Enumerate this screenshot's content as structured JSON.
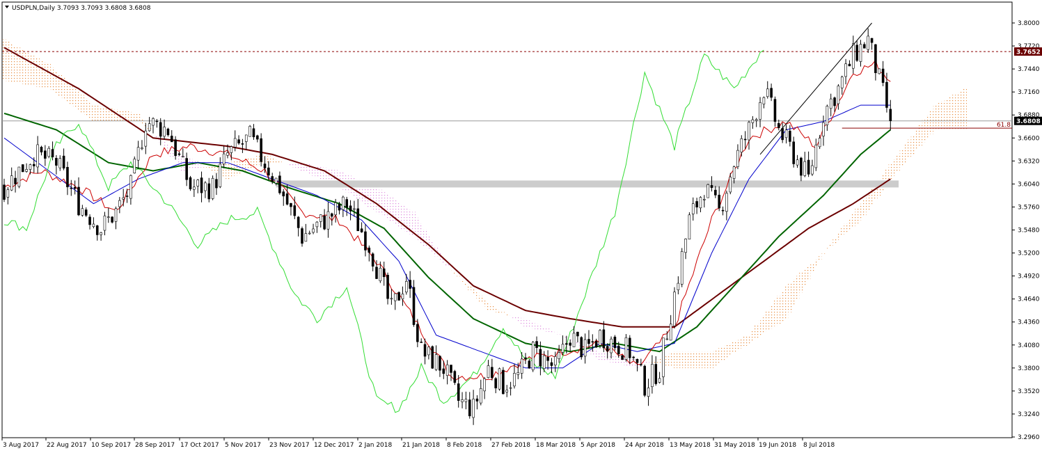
{
  "window": {
    "symbol_line": "USDPLN,Daily  3.7093 3.7093 3.6808 3.6808",
    "marker_icon": "triangle-down-icon"
  },
  "colors": {
    "background": "#ffffff",
    "frame": "#000000",
    "grid_none": "none",
    "bull_candle": "#ffffff",
    "bear_candle": "#000000",
    "ma_green": "#006400",
    "ma_brown": "#6b0000",
    "kijun_blue": "#0000cc",
    "tenkan_red": "#cc0000",
    "chikou_lime": "#33dd33",
    "cloud_bear": "#dd88dd",
    "cloud_bull": "#e88a3a",
    "resistance_line": "#8b0000",
    "current_price_bg": "#000000",
    "resistance_price_bg": "#6b0000",
    "zone_band": "#cccccc"
  },
  "chart_data": {
    "type": "candlestick",
    "title": "USDPLN,Daily",
    "ohlc_header": [
      "3.7093",
      "3.7093",
      "3.6808",
      "3.6808"
    ],
    "ylim": [
      3.296,
      3.8
    ],
    "y_ticks": [
      "3.8000",
      "3.7720",
      "3.7440",
      "3.7160",
      "3.6880",
      "3.6600",
      "3.6320",
      "3.6040",
      "3.5760",
      "3.5480",
      "3.5200",
      "3.4920",
      "3.4640",
      "3.4360",
      "3.4080",
      "3.3800",
      "3.3520",
      "3.3240",
      "3.2960"
    ],
    "x_ticks": [
      "3 Aug 2017",
      "22 Aug 2017",
      "10 Sep 2017",
      "28 Sep 2017",
      "17 Oct 2017",
      "5 Nov 2017",
      "23 Nov 2017",
      "12 Dec 2017",
      "2 Jan 2018",
      "21 Jan 2018",
      "8 Feb 2018",
      "27 Feb 2018",
      "18 Mar 2018",
      "5 Apr 2018",
      "24 Apr 2018",
      "13 May 2018",
      "31 May 2018",
      "19 Jun 2018",
      "8 Jul 2018"
    ],
    "price_labels": {
      "resistance": "3.7652",
      "current": "3.6808"
    },
    "fib_label": "61.8",
    "zone_price": 3.604,
    "resistance_price": 3.7652,
    "current_price": 3.6808,
    "fib_price": 3.672,
    "series_knots": {
      "close": [
        [
          0,
          3.6
        ],
        [
          4,
          3.62
        ],
        [
          8,
          3.64
        ],
        [
          14,
          3.63
        ],
        [
          20,
          3.58
        ],
        [
          26,
          3.55
        ],
        [
          30,
          3.57
        ],
        [
          34,
          3.6
        ],
        [
          38,
          3.68
        ],
        [
          44,
          3.67
        ],
        [
          50,
          3.6
        ],
        [
          56,
          3.6
        ],
        [
          60,
          3.64
        ],
        [
          66,
          3.66
        ],
        [
          70,
          3.63
        ],
        [
          74,
          3.6
        ],
        [
          80,
          3.54
        ],
        [
          86,
          3.56
        ],
        [
          92,
          3.58
        ],
        [
          98,
          3.53
        ],
        [
          104,
          3.45
        ],
        [
          108,
          3.49
        ],
        [
          112,
          3.4
        ],
        [
          118,
          3.38
        ],
        [
          122,
          3.34
        ],
        [
          126,
          3.33
        ],
        [
          130,
          3.38
        ],
        [
          134,
          3.36
        ],
        [
          138,
          3.37
        ],
        [
          142,
          3.4
        ],
        [
          148,
          3.38
        ],
        [
          152,
          3.42
        ],
        [
          156,
          3.4
        ],
        [
          160,
          3.42
        ],
        [
          164,
          3.41
        ],
        [
          168,
          3.4
        ],
        [
          172,
          3.36
        ],
        [
          176,
          3.38
        ],
        [
          180,
          3.47
        ],
        [
          184,
          3.56
        ],
        [
          188,
          3.6
        ],
        [
          192,
          3.57
        ],
        [
          196,
          3.63
        ],
        [
          200,
          3.67
        ],
        [
          204,
          3.72
        ],
        [
          208,
          3.67
        ],
        [
          212,
          3.64
        ],
        [
          216,
          3.61
        ],
        [
          220,
          3.69
        ],
        [
          224,
          3.72
        ],
        [
          228,
          3.76
        ],
        [
          232,
          3.78
        ],
        [
          235,
          3.73
        ],
        [
          238,
          3.6808
        ]
      ],
      "tenkan": [
        [
          0,
          3.6
        ],
        [
          10,
          3.62
        ],
        [
          20,
          3.6
        ],
        [
          30,
          3.57
        ],
        [
          40,
          3.64
        ],
        [
          50,
          3.65
        ],
        [
          60,
          3.64
        ],
        [
          70,
          3.62
        ],
        [
          80,
          3.57
        ],
        [
          90,
          3.56
        ],
        [
          100,
          3.51
        ],
        [
          110,
          3.44
        ],
        [
          120,
          3.37
        ],
        [
          130,
          3.37
        ],
        [
          140,
          3.39
        ],
        [
          150,
          3.4
        ],
        [
          160,
          3.41
        ],
        [
          170,
          3.38
        ],
        [
          180,
          3.43
        ],
        [
          190,
          3.56
        ],
        [
          200,
          3.66
        ],
        [
          210,
          3.68
        ],
        [
          218,
          3.65
        ],
        [
          228,
          3.74
        ],
        [
          234,
          3.75
        ],
        [
          238,
          3.73
        ]
      ],
      "kijun": [
        [
          0,
          3.66
        ],
        [
          12,
          3.62
        ],
        [
          24,
          3.58
        ],
        [
          36,
          3.61
        ],
        [
          48,
          3.63
        ],
        [
          60,
          3.63
        ],
        [
          72,
          3.61
        ],
        [
          84,
          3.59
        ],
        [
          96,
          3.56
        ],
        [
          106,
          3.51
        ],
        [
          116,
          3.42
        ],
        [
          128,
          3.4
        ],
        [
          140,
          3.38
        ],
        [
          150,
          3.38
        ],
        [
          160,
          3.41
        ],
        [
          170,
          3.4
        ],
        [
          180,
          3.41
        ],
        [
          190,
          3.52
        ],
        [
          200,
          3.61
        ],
        [
          210,
          3.67
        ],
        [
          220,
          3.68
        ],
        [
          230,
          3.7
        ],
        [
          238,
          3.7
        ]
      ],
      "ma_green": [
        [
          0,
          3.69
        ],
        [
          14,
          3.67
        ],
        [
          28,
          3.63
        ],
        [
          40,
          3.62
        ],
        [
          52,
          3.63
        ],
        [
          64,
          3.62
        ],
        [
          76,
          3.6
        ],
        [
          90,
          3.58
        ],
        [
          102,
          3.55
        ],
        [
          114,
          3.49
        ],
        [
          126,
          3.44
        ],
        [
          140,
          3.41
        ],
        [
          152,
          3.4
        ],
        [
          164,
          3.41
        ],
        [
          176,
          3.4
        ],
        [
          186,
          3.43
        ],
        [
          196,
          3.48
        ],
        [
          208,
          3.54
        ],
        [
          220,
          3.59
        ],
        [
          230,
          3.64
        ],
        [
          238,
          3.67
        ]
      ],
      "ma_brown": [
        [
          0,
          3.77
        ],
        [
          20,
          3.72
        ],
        [
          40,
          3.66
        ],
        [
          60,
          3.65
        ],
        [
          72,
          3.64
        ],
        [
          86,
          3.62
        ],
        [
          100,
          3.58
        ],
        [
          114,
          3.53
        ],
        [
          126,
          3.48
        ],
        [
          140,
          3.45
        ],
        [
          152,
          3.44
        ],
        [
          166,
          3.43
        ],
        [
          180,
          3.43
        ],
        [
          192,
          3.47
        ],
        [
          204,
          3.51
        ],
        [
          216,
          3.55
        ],
        [
          228,
          3.58
        ],
        [
          238,
          3.61
        ]
      ],
      "chikou": [
        [
          0,
          3.56
        ],
        [
          6,
          3.55
        ],
        [
          14,
          3.65
        ],
        [
          20,
          3.68
        ],
        [
          28,
          3.6
        ],
        [
          34,
          3.63
        ],
        [
          44,
          3.58
        ],
        [
          52,
          3.53
        ],
        [
          60,
          3.56
        ],
        [
          68,
          3.57
        ],
        [
          78,
          3.47
        ],
        [
          84,
          3.44
        ],
        [
          92,
          3.48
        ],
        [
          100,
          3.34
        ],
        [
          106,
          3.33
        ],
        [
          112,
          3.38
        ],
        [
          118,
          3.34
        ],
        [
          126,
          3.37
        ],
        [
          134,
          3.43
        ],
        [
          140,
          3.39
        ],
        [
          148,
          3.37
        ],
        [
          156,
          3.47
        ],
        [
          164,
          3.57
        ],
        [
          172,
          3.74
        ],
        [
          180,
          3.65
        ],
        [
          188,
          3.76
        ],
        [
          196,
          3.72
        ],
        [
          204,
          3.77
        ]
      ],
      "span_a": [
        [
          0,
          3.78
        ],
        [
          12,
          3.75
        ],
        [
          24,
          3.7
        ],
        [
          36,
          3.69
        ],
        [
          48,
          3.62
        ],
        [
          60,
          3.63
        ],
        [
          70,
          3.64
        ],
        [
          80,
          3.62
        ],
        [
          90,
          3.6
        ],
        [
          100,
          3.57
        ],
        [
          110,
          3.54
        ],
        [
          120,
          3.5
        ],
        [
          130,
          3.46
        ],
        [
          140,
          3.43
        ],
        [
          150,
          3.42
        ],
        [
          160,
          3.39
        ],
        [
          170,
          3.38
        ],
        [
          180,
          3.4
        ],
        [
          190,
          3.4
        ],
        [
          200,
          3.42
        ],
        [
          210,
          3.48
        ],
        [
          220,
          3.52
        ],
        [
          230,
          3.58
        ],
        [
          240,
          3.64
        ],
        [
          250,
          3.7
        ],
        [
          258,
          3.72
        ]
      ],
      "span_b": [
        [
          0,
          3.73
        ],
        [
          12,
          3.72
        ],
        [
          24,
          3.68
        ],
        [
          36,
          3.68
        ],
        [
          48,
          3.64
        ],
        [
          60,
          3.61
        ],
        [
          70,
          3.63
        ],
        [
          80,
          3.63
        ],
        [
          90,
          3.62
        ],
        [
          100,
          3.6
        ],
        [
          110,
          3.57
        ],
        [
          120,
          3.5
        ],
        [
          130,
          3.45
        ],
        [
          140,
          3.44
        ],
        [
          150,
          3.42
        ],
        [
          160,
          3.4
        ],
        [
          170,
          3.39
        ],
        [
          180,
          3.38
        ],
        [
          190,
          3.38
        ],
        [
          200,
          3.41
        ],
        [
          210,
          3.44
        ],
        [
          220,
          3.52
        ],
        [
          230,
          3.56
        ],
        [
          240,
          3.62
        ],
        [
          250,
          3.67
        ],
        [
          258,
          3.67
        ]
      ]
    },
    "bar_count": 239
  }
}
